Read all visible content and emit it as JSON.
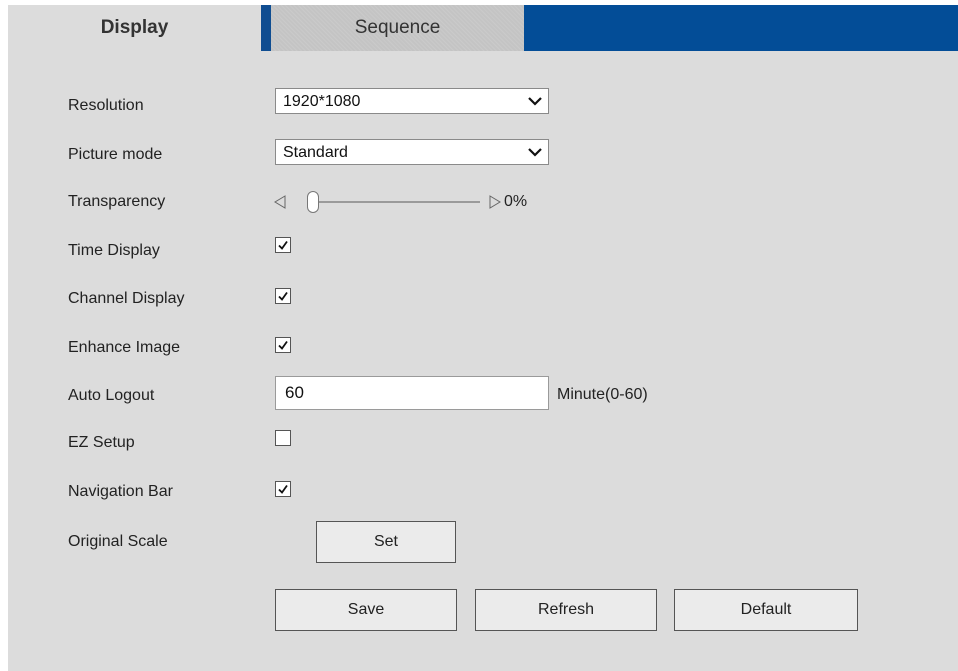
{
  "tabs": {
    "display": "Display",
    "sequence": "Sequence"
  },
  "colors": {
    "accent": "#034d97",
    "panel_bg": "#dcdcdc"
  },
  "settings": {
    "resolution": {
      "label": "Resolution",
      "value": "1920*1080"
    },
    "picture_mode": {
      "label": "Picture mode",
      "value": "Standard"
    },
    "transparency": {
      "label": "Transparency",
      "value": "0%",
      "level": 0
    },
    "time_display": {
      "label": "Time Display",
      "checked": true
    },
    "channel_display": {
      "label": "Channel Display",
      "checked": true
    },
    "enhance_image": {
      "label": "Enhance Image",
      "checked": true
    },
    "auto_logout": {
      "label": "Auto Logout",
      "value": "60",
      "unit": "Minute(0-60)"
    },
    "ez_setup": {
      "label": "EZ Setup",
      "checked": false
    },
    "navigation_bar": {
      "label": "Navigation Bar",
      "checked": true
    },
    "original_scale": {
      "label": "Original Scale",
      "button": "Set"
    }
  },
  "actions": {
    "save": "Save",
    "refresh": "Refresh",
    "default": "Default"
  }
}
